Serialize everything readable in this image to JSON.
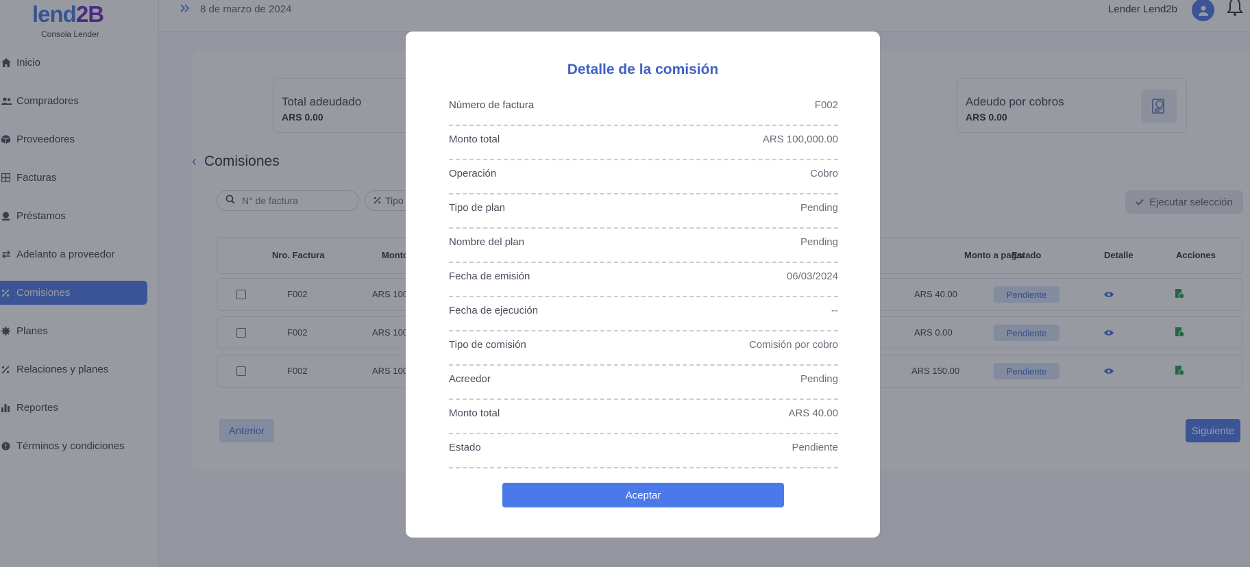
{
  "brand": {
    "logo_lend": "lend",
    "logo_2b": "2B",
    "subtitle": "Consola Lender"
  },
  "sidebar": {
    "items": [
      {
        "label": "Inicio",
        "icon": "home-icon"
      },
      {
        "label": "Compradores",
        "icon": "users-icon"
      },
      {
        "label": "Proveedores",
        "icon": "box-icon"
      },
      {
        "label": "Facturas",
        "icon": "grid-icon"
      },
      {
        "label": "Préstamos",
        "icon": "loan-icon"
      },
      {
        "label": "Adelanto a proveedor",
        "icon": "transfer-icon"
      },
      {
        "label": "Comisiones",
        "icon": "percent-icon",
        "active": true
      },
      {
        "label": "Planes",
        "icon": "gear-icon"
      },
      {
        "label": "Relaciones y planes",
        "icon": "percent-icon"
      },
      {
        "label": "Reportes",
        "icon": "bar-chart-icon"
      },
      {
        "label": "Términos y condiciones",
        "icon": "info-icon"
      }
    ]
  },
  "header": {
    "date": "8 de marzo de 2024",
    "user_name": "Lender Lend2b"
  },
  "stats": [
    {
      "title": "Total adeudado",
      "value": "ARS 0.00"
    },
    {
      "title": "Adeudo por cobros",
      "value": "ARS 0.00"
    }
  ],
  "page": {
    "section_title": "Comisiones",
    "search_placeholder": "N° de factura",
    "filter_label": "Tipo",
    "execute_label": "Ejecutar selección",
    "prev_label": "Anterior",
    "next_label": "Siguiente"
  },
  "table": {
    "headers": {
      "invoice": "Nro. Factura",
      "amount": "Monto",
      "to_pay": "Monto a pagar",
      "status": "Estado",
      "detail": "Detalle",
      "actions": "Acciones"
    },
    "rows": [
      {
        "invoice": "F002",
        "amount": "ARS 100",
        "to_pay": "ARS 40.00",
        "status": "Pendiente"
      },
      {
        "invoice": "F002",
        "amount": "ARS 100",
        "to_pay": "ARS 0.00",
        "status": "Pendiente"
      },
      {
        "invoice": "F002",
        "amount": "ARS 100",
        "to_pay": "ARS 150.00",
        "status": "Pendiente"
      }
    ]
  },
  "modal": {
    "title": "Detalle de la comisión",
    "rows": [
      {
        "label": "Número de factura",
        "value": "F002"
      },
      {
        "label": "Monto total",
        "value": "ARS 100,000.00"
      },
      {
        "label": "Operación",
        "value": "Cobro"
      },
      {
        "label": "Tipo de plan",
        "value": "Pending"
      },
      {
        "label": "Nombre del plan",
        "value": "Pending"
      },
      {
        "label": "Fecha de emisión",
        "value": "06/03/2024"
      },
      {
        "label": "Fecha de ejecución",
        "value": "--"
      },
      {
        "label": "Tipo de comisión",
        "value": "Comisión por cobro"
      },
      {
        "label": "Acreedor",
        "value": "Pending"
      },
      {
        "label": "Monto total",
        "value": "ARS 40.00"
      },
      {
        "label": "Estado",
        "value": "Pendiente"
      }
    ],
    "accept_label": "Aceptar"
  },
  "colors": {
    "accent": "#4b79e9",
    "modal_title": "#3e62c6",
    "badge_bg": "#d7e2fa",
    "badge_text": "#3f6fdd",
    "action_green": "#1e9e55"
  }
}
